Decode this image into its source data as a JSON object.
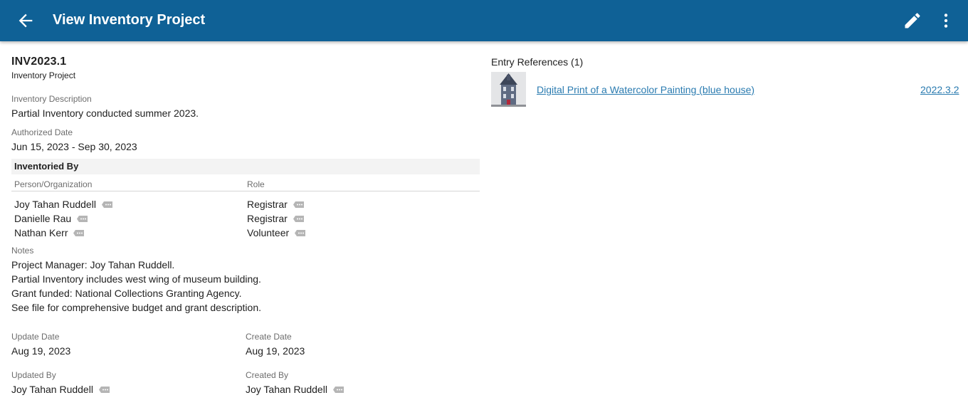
{
  "appbar": {
    "title": "View Inventory Project",
    "icons": {
      "back": "arrow-left-icon",
      "edit": "pencil-icon",
      "more": "more-vert-icon"
    },
    "background": "#0f6196"
  },
  "project": {
    "id": "INV2023.1",
    "type": "Inventory Project",
    "description_label": "Inventory Description",
    "description": "Partial Inventory conducted summer 2023.",
    "authorized_label": "Authorized Date",
    "authorized": "Jun 15, 2023 - Sep 30, 2023"
  },
  "inventoried_by": {
    "heading": "Inventoried By",
    "col_person": "Person/Organization",
    "col_role": "Role",
    "rows": [
      {
        "person": "Joy Tahan Ruddell",
        "role": "Registrar"
      },
      {
        "person": "Danielle Rau",
        "role": "Registrar"
      },
      {
        "person": "Nathan Kerr",
        "role": "Volunteer"
      }
    ]
  },
  "notes": {
    "label": "Notes",
    "lines": [
      "Project Manager: Joy Tahan Ruddell.",
      "Partial Inventory includes west wing of museum building.",
      "Grant funded: National Collections Granting Agency.",
      "See file for comprehensive budget and grant description."
    ]
  },
  "meta": {
    "update_date_label": "Update Date",
    "update_date": "Aug 19, 2023",
    "create_date_label": "Create Date",
    "create_date": "Aug 19, 2023",
    "updated_by_label": "Updated By",
    "updated_by": "Joy Tahan Ruddell",
    "created_by_label": "Created By",
    "created_by": "Joy Tahan Ruddell"
  },
  "entry_references": {
    "title": "Entry References (1)",
    "items": [
      {
        "title": "Digital Print of a Watercolor Painting (blue house)",
        "number": "2022.3.2",
        "thumbnail": "blue-house-thumbnail"
      }
    ]
  },
  "colors": {
    "link": "#2a7bb0",
    "label": "#6d6d6d",
    "section_bg": "#f3f3f3",
    "tag": "#b5b5b5"
  }
}
